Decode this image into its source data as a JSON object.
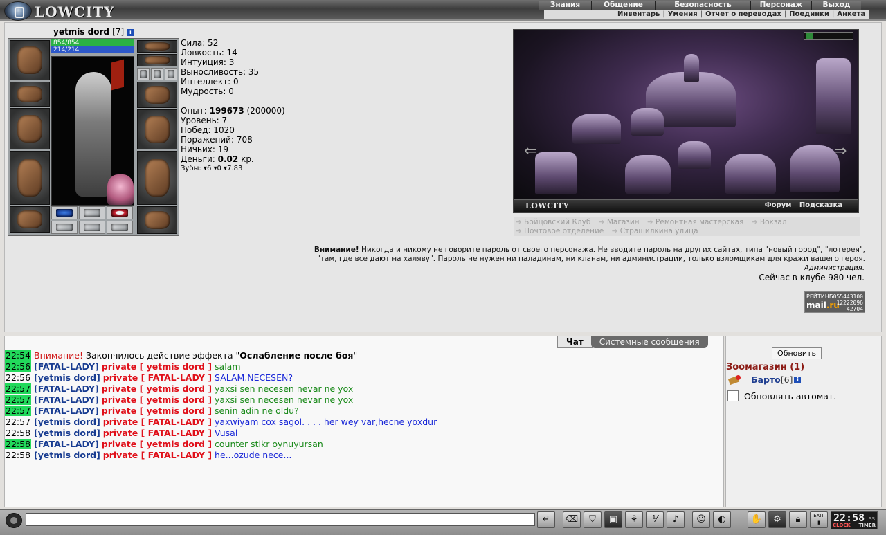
{
  "app": {
    "logo_text": "LOWCITY"
  },
  "menu": {
    "main": [
      "Знания",
      "Общение",
      "Безопасность",
      "Персонаж",
      "Выход"
    ],
    "sub": [
      "Инвентарь",
      "Умения",
      "Отчет о переводах",
      "Поединки",
      "Анкета"
    ]
  },
  "character": {
    "name": "yetmis dord",
    "level": "[7]",
    "info_icon": "i",
    "hp": "854/854",
    "mp": "214/214",
    "hp_fill": 1.0,
    "mp_fill": 1.0,
    "stats": [
      "Сила: 52",
      "Ловкость: 14",
      "Интуиция: 3",
      "Выносливость: 35",
      "Интеллект: 0",
      "Мудрость: 0"
    ],
    "exp_label": "Опыт: ",
    "exp_value": "199673",
    "exp_next": " (200000)",
    "level_line": "Уровень: 7",
    "wins": "Побед: 1020",
    "losses": "Поражений: 708",
    "draws": "Ничьих: 19",
    "money_label": "Деньги: ",
    "money_value": "0.02",
    "money_unit": " кр.",
    "teeth": "Зубы: ▾6 ▾0 ▾7.83"
  },
  "location": {
    "name": "LOWCITY",
    "links": [
      "Форум",
      "Подсказка"
    ],
    "goto_row1": [
      "Бойцовский Клуб",
      "Магазин",
      "Ремонтная мастерская",
      "Вокзал"
    ],
    "goto_row2": [
      "Почтовое отделение",
      "Страшилкина улица"
    ]
  },
  "warning": {
    "title": "Внимание!",
    "text1": " Никогда и никому не говорите пароль от своего персонажа. Не вводите пароль на других сайтах, типа \"новый город\", \"лотерея\",",
    "text2a": "\"там, где все дают на халяву\". Пароль не нужен ни паладинам, ни кланам, ни администрации, ",
    "text2_link": "только взломщикам",
    "text2b": " для кражи вашего героя.",
    "admin": "Администрация.",
    "online": "Сейчас в клубе 980 чел."
  },
  "counter": {
    "label": "РЕЙТИНГ",
    "brand_a": "mail",
    "brand_b": ".ru",
    "nums": [
      "5055443100",
      "12222096",
      "42704"
    ]
  },
  "chat": {
    "tabs": [
      "Чат",
      "Системные сообщения"
    ],
    "system_msg": {
      "time": "22:54",
      "warn": "Внимание!",
      "text": " Закончилось действие эффекта \"",
      "effect": "Ослабление после боя",
      "end": "\""
    },
    "messages": [
      {
        "time": "22:56",
        "hl": true,
        "from": "[FATAL-LADY]",
        "to": "private [ yetmis dord ]",
        "text": "salam",
        "color": "green"
      },
      {
        "time": "22:56",
        "hl": false,
        "from": "[yetmis dord]",
        "to": "private [ FATAL-LADY ]",
        "text": "SALAM.NECESEN?",
        "color": "blue"
      },
      {
        "time": "22:57",
        "hl": true,
        "from": "[FATAL-LADY]",
        "to": "private [ yetmis dord ]",
        "text": "yaxsi sen necesen nevar ne yox",
        "color": "green"
      },
      {
        "time": "22:57",
        "hl": true,
        "from": "[FATAL-LADY]",
        "to": "private [ yetmis dord ]",
        "text": "yaxsi sen necesen nevar ne yox",
        "color": "green"
      },
      {
        "time": "22:57",
        "hl": true,
        "from": "[FATAL-LADY]",
        "to": "private [ yetmis dord ]",
        "text": "senin adin ne oldu?",
        "color": "green"
      },
      {
        "time": "22:57",
        "hl": false,
        "from": "[yetmis dord]",
        "to": "private [ FATAL-LADY ]",
        "text": "yaxwiyam cox sagol. . . . her wey var,hecne yoxdur",
        "color": "blue"
      },
      {
        "time": "22:58",
        "hl": false,
        "from": "[yetmis dord]",
        "to": "private [ FATAL-LADY ]",
        "text": "Vusal",
        "color": "blue"
      },
      {
        "time": "22:58",
        "hl": true,
        "from": "[FATAL-LADY]",
        "to": "private [ yetmis dord ]",
        "text": "counter stikr oynuyursan",
        "color": "green"
      },
      {
        "time": "22:58",
        "hl": false,
        "from": "[yetmis dord]",
        "to": "private [ FATAL-LADY ]",
        "text": "he...ozude nece...",
        "color": "blue"
      }
    ]
  },
  "room": {
    "refresh_label": "Обновить",
    "title": "Зоомагазин (1)",
    "user_name": "Барто",
    "user_level": "[6]",
    "auto_label": "Обновлять автомат."
  },
  "clock": {
    "time": "22:58",
    "seconds_label": "SS",
    "clock_label": "CLOCK",
    "timer_label": "TIMER"
  },
  "toolbar": {
    "exit_label": "EXIT",
    "buttons": [
      "send-arrow-icon",
      "eraser-icon",
      "filter-icon",
      "save-icon",
      "dance-icon",
      "speed-icon",
      "sound-icon",
      "smiley-icon",
      "trap-icon",
      "hand-icon",
      "gear-icon",
      "lock-icon",
      "exit-icon"
    ]
  }
}
